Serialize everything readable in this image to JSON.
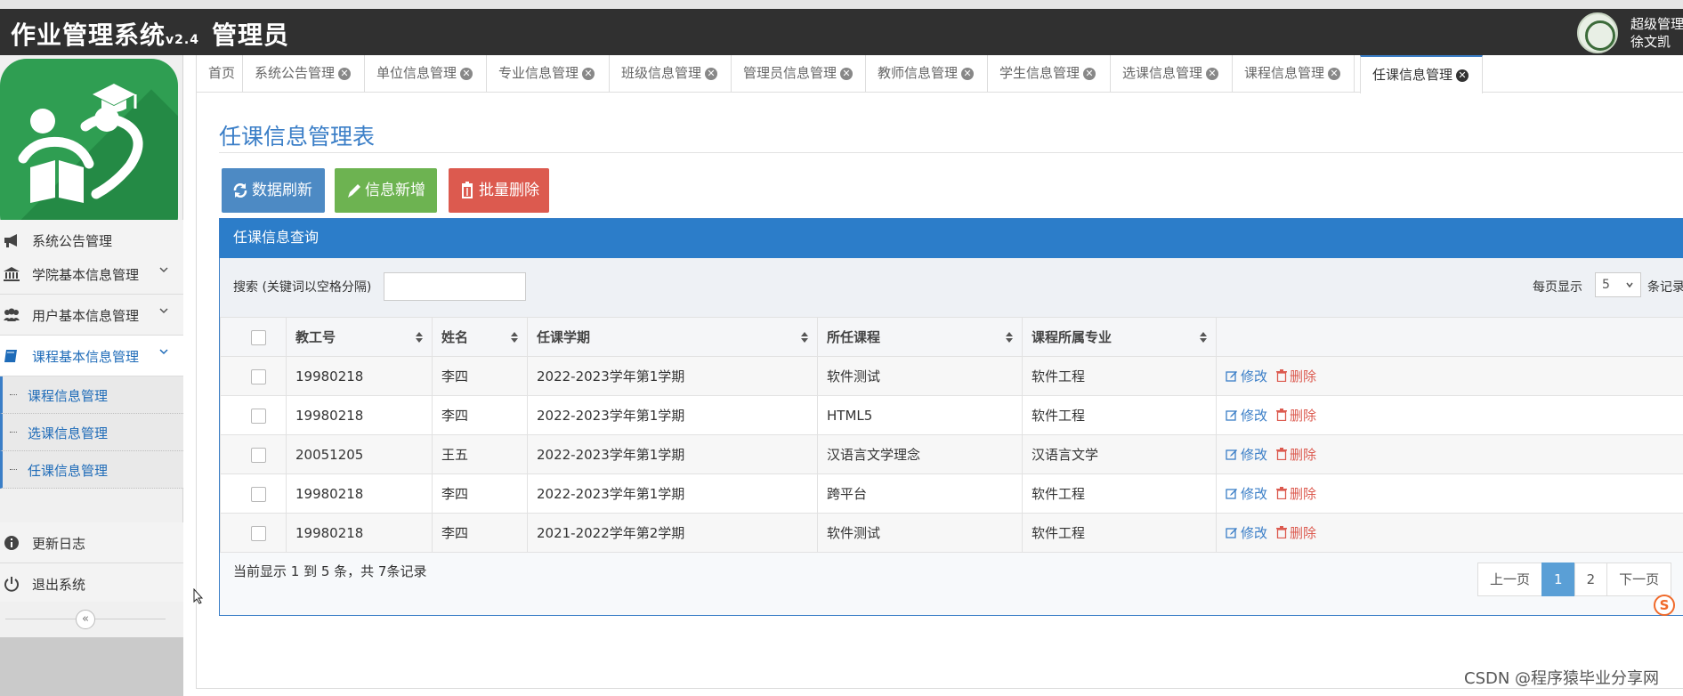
{
  "header": {
    "app_title": "作业管理系统",
    "version": "v2.4",
    "role_title": "管理员",
    "user_role": "超级管理",
    "user_name": "徐文凯"
  },
  "sidebar": {
    "items": [
      {
        "label": "系统公告管理",
        "icon": "megaphone-icon"
      },
      {
        "label": "学院基本信息管理",
        "icon": "bank-icon"
      },
      {
        "label": "用户基本信息管理",
        "icon": "users-icon"
      },
      {
        "label": "课程基本信息管理",
        "icon": "book-icon"
      },
      {
        "label": "更新日志",
        "icon": "info-icon"
      },
      {
        "label": "退出系统",
        "icon": "power-icon"
      }
    ],
    "subitems": [
      {
        "label": "课程信息管理"
      },
      {
        "label": "选课信息管理"
      },
      {
        "label": "任课信息管理"
      }
    ],
    "collapse_glyph": "«"
  },
  "tabs": [
    {
      "label": "首页"
    },
    {
      "label": "系统公告管理"
    },
    {
      "label": "单位信息管理"
    },
    {
      "label": "专业信息管理"
    },
    {
      "label": "班级信息管理"
    },
    {
      "label": "管理员信息管理"
    },
    {
      "label": "教师信息管理"
    },
    {
      "label": "学生信息管理"
    },
    {
      "label": "选课信息管理"
    },
    {
      "label": "课程信息管理"
    },
    {
      "label": "任课信息管理"
    }
  ],
  "page": {
    "title": "任课信息管理表",
    "buttons": {
      "refresh": "数据刷新",
      "add": "信息新增",
      "batch_delete": "批量删除"
    },
    "panel_title": "任课信息查询",
    "search_label": "搜索 (关键词以空格分隔)",
    "search_value": "",
    "per_page_label": "每页显示",
    "per_page_value": "5",
    "per_page_tail": "条记录",
    "columns": [
      "教工号",
      "姓名",
      "任课学期",
      "所任课程",
      "课程所属专业"
    ],
    "rows": [
      [
        "19980218",
        "李四",
        "2022-2023学年第1学期",
        "软件测试",
        "软件工程"
      ],
      [
        "19980218",
        "李四",
        "2022-2023学年第1学期",
        "HTML5",
        "软件工程"
      ],
      [
        "20051205",
        "王五",
        "2022-2023学年第1学期",
        "汉语言文学理念",
        "汉语言文学"
      ],
      [
        "19980218",
        "李四",
        "2022-2023学年第1学期",
        "跨平台",
        "软件工程"
      ],
      [
        "19980218",
        "李四",
        "2021-2022学年第2学期",
        "软件测试",
        "软件工程"
      ]
    ],
    "row_actions": {
      "edit": "修改",
      "delete": "删除"
    },
    "footer_info": "当前显示 1 到 5 条，共 7条记录",
    "pager": {
      "prev": "上一页",
      "pages": [
        "1",
        "2"
      ],
      "current": "1",
      "next": "下一页"
    }
  },
  "watermark": "CSDN @程序猿毕业分享网",
  "colors": {
    "header_bg": "#303030",
    "accent": "#3a7ec7",
    "panel_head": "#2c7dc9",
    "refresh": "#4d8ac4",
    "add": "#6db351",
    "delete": "#dc5a4f",
    "logo_green": "#2f9e52"
  }
}
